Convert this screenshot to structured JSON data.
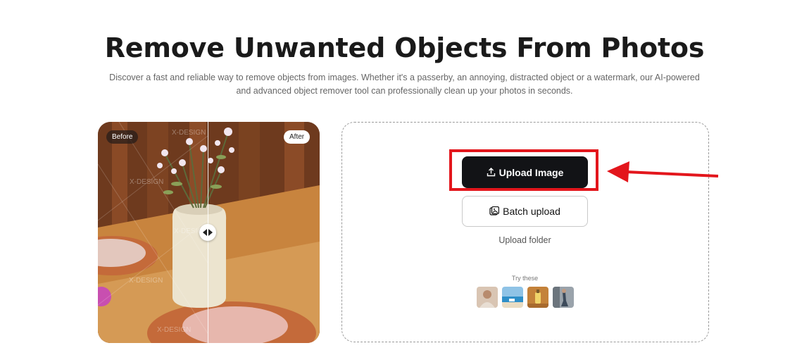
{
  "page": {
    "title": "Remove Unwanted Objects From Photos",
    "subtitle_line1": "Discover a fast and reliable way to remove objects from images. Whether it's a passerby, an annoying, distracted object or a watermark, our AI-powered",
    "subtitle_line2": "and advanced object remover tool can professionally clean up your photos in seconds."
  },
  "preview": {
    "before_label": "Before",
    "after_label": "After",
    "watermark": "X-DESIGN"
  },
  "upload": {
    "upload_image_label": "Upload Image",
    "batch_upload_label": "Batch upload",
    "upload_folder_label": "Upload folder",
    "try_these_label": "Try these",
    "samples": [
      "portrait-sample",
      "beach-sample",
      "still-life-sample",
      "street-sample"
    ]
  },
  "colors": {
    "primary_button": "#121316",
    "highlight": "#e3161c",
    "arrow": "#e3161c"
  }
}
